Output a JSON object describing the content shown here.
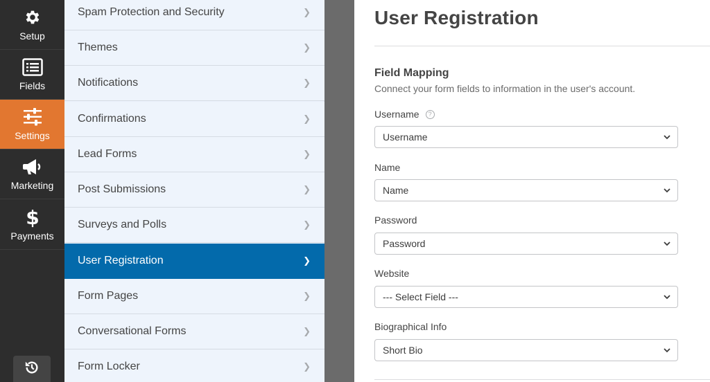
{
  "rail": {
    "items": [
      {
        "label": "Setup",
        "icon": "gear-icon"
      },
      {
        "label": "Fields",
        "icon": "fields-icon"
      },
      {
        "label": "Settings",
        "icon": "sliders-icon",
        "active": true
      },
      {
        "label": "Marketing",
        "icon": "megaphone-icon"
      },
      {
        "label": "Payments",
        "icon": "dollar-icon"
      }
    ],
    "undo_icon": "history-icon"
  },
  "panel": {
    "items": [
      {
        "label": "Spam Protection and Security"
      },
      {
        "label": "Themes"
      },
      {
        "label": "Notifications"
      },
      {
        "label": "Confirmations"
      },
      {
        "label": "Lead Forms"
      },
      {
        "label": "Post Submissions"
      },
      {
        "label": "Surveys and Polls"
      },
      {
        "label": "User Registration",
        "active": true
      },
      {
        "label": "Form Pages"
      },
      {
        "label": "Conversational Forms"
      },
      {
        "label": "Form Locker"
      }
    ]
  },
  "content": {
    "title": "User Registration",
    "section_title": "Field Mapping",
    "section_desc": "Connect your form fields to information in the user's account.",
    "fields": [
      {
        "label": "Username",
        "value": "Username",
        "help": true
      },
      {
        "label": "Name",
        "value": "Name"
      },
      {
        "label": "Password",
        "value": "Password"
      },
      {
        "label": "Website",
        "value": "--- Select Field ---"
      },
      {
        "label": "Biographical Info",
        "value": "Short Bio"
      }
    ]
  },
  "colors": {
    "rail_bg": "#2d2d2d",
    "rail_active": "#e27730",
    "panel_bg": "#eef4fc",
    "panel_active": "#036aab",
    "text": "#444444"
  }
}
